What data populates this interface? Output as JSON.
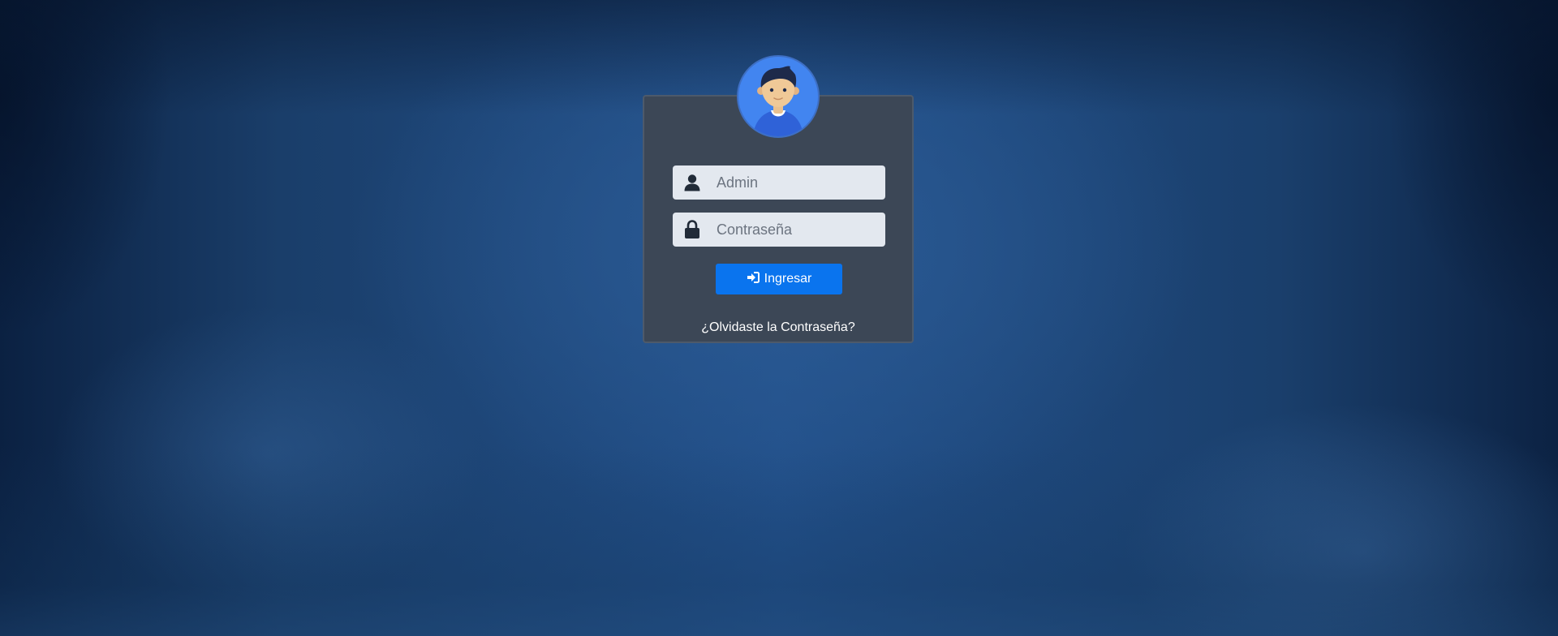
{
  "login": {
    "username_placeholder": "Admin",
    "password_placeholder": "Contraseña",
    "submit_label": "Ingresar",
    "forgot_password_label": "¿Olvidaste la Contraseña?"
  },
  "icons": {
    "avatar": "user-avatar-icon",
    "username": "user-icon",
    "password": "lock-icon",
    "submit": "sign-in-icon"
  },
  "colors": {
    "card_background": "#3c4756",
    "input_background": "#e3e8ef",
    "button_primary": "#0a74ee",
    "avatar_background": "#4285f0"
  }
}
